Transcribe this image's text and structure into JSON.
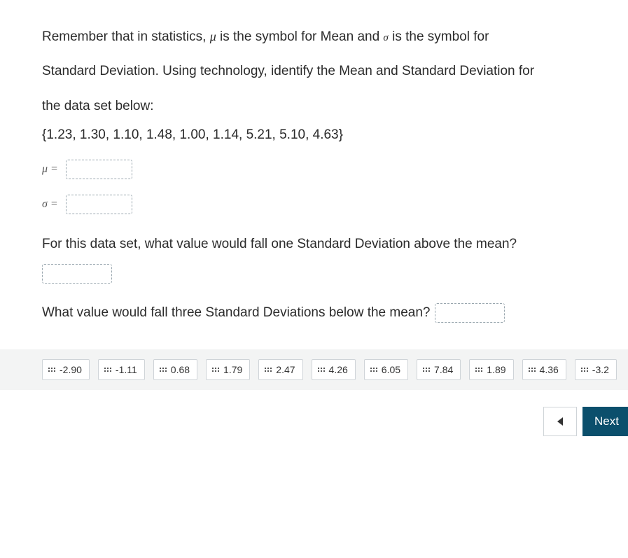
{
  "question": {
    "intro_html_parts": {
      "p1a": "Remember that in statistics, ",
      "p1b": " is the symbol for Mean and ",
      "p1c": " is the symbol for",
      "p2": "Standard Deviation.  Using technology, identify the Mean and Standard Deviation for",
      "p3": "the data set below:"
    },
    "mu_symbol": "μ",
    "sigma_symbol": "σ",
    "dataset": "{1.23, 1.30, 1.10, 1.48, 1.00, 1.14, 5.21, 5.10, 4.63}",
    "mu_label": "μ =",
    "sigma_label": "σ =",
    "followup1": "For this data set, what value would fall one Standard Deviation above the mean?",
    "followup2": "What value would fall three Standard Deviations below the mean?"
  },
  "tiles": [
    "-2.90",
    "-1.11",
    "0.68",
    "1.79",
    "2.47",
    "4.26",
    "6.05",
    "7.84",
    "1.89",
    "4.36",
    "-3.2"
  ],
  "nav": {
    "next_label": "Next"
  }
}
